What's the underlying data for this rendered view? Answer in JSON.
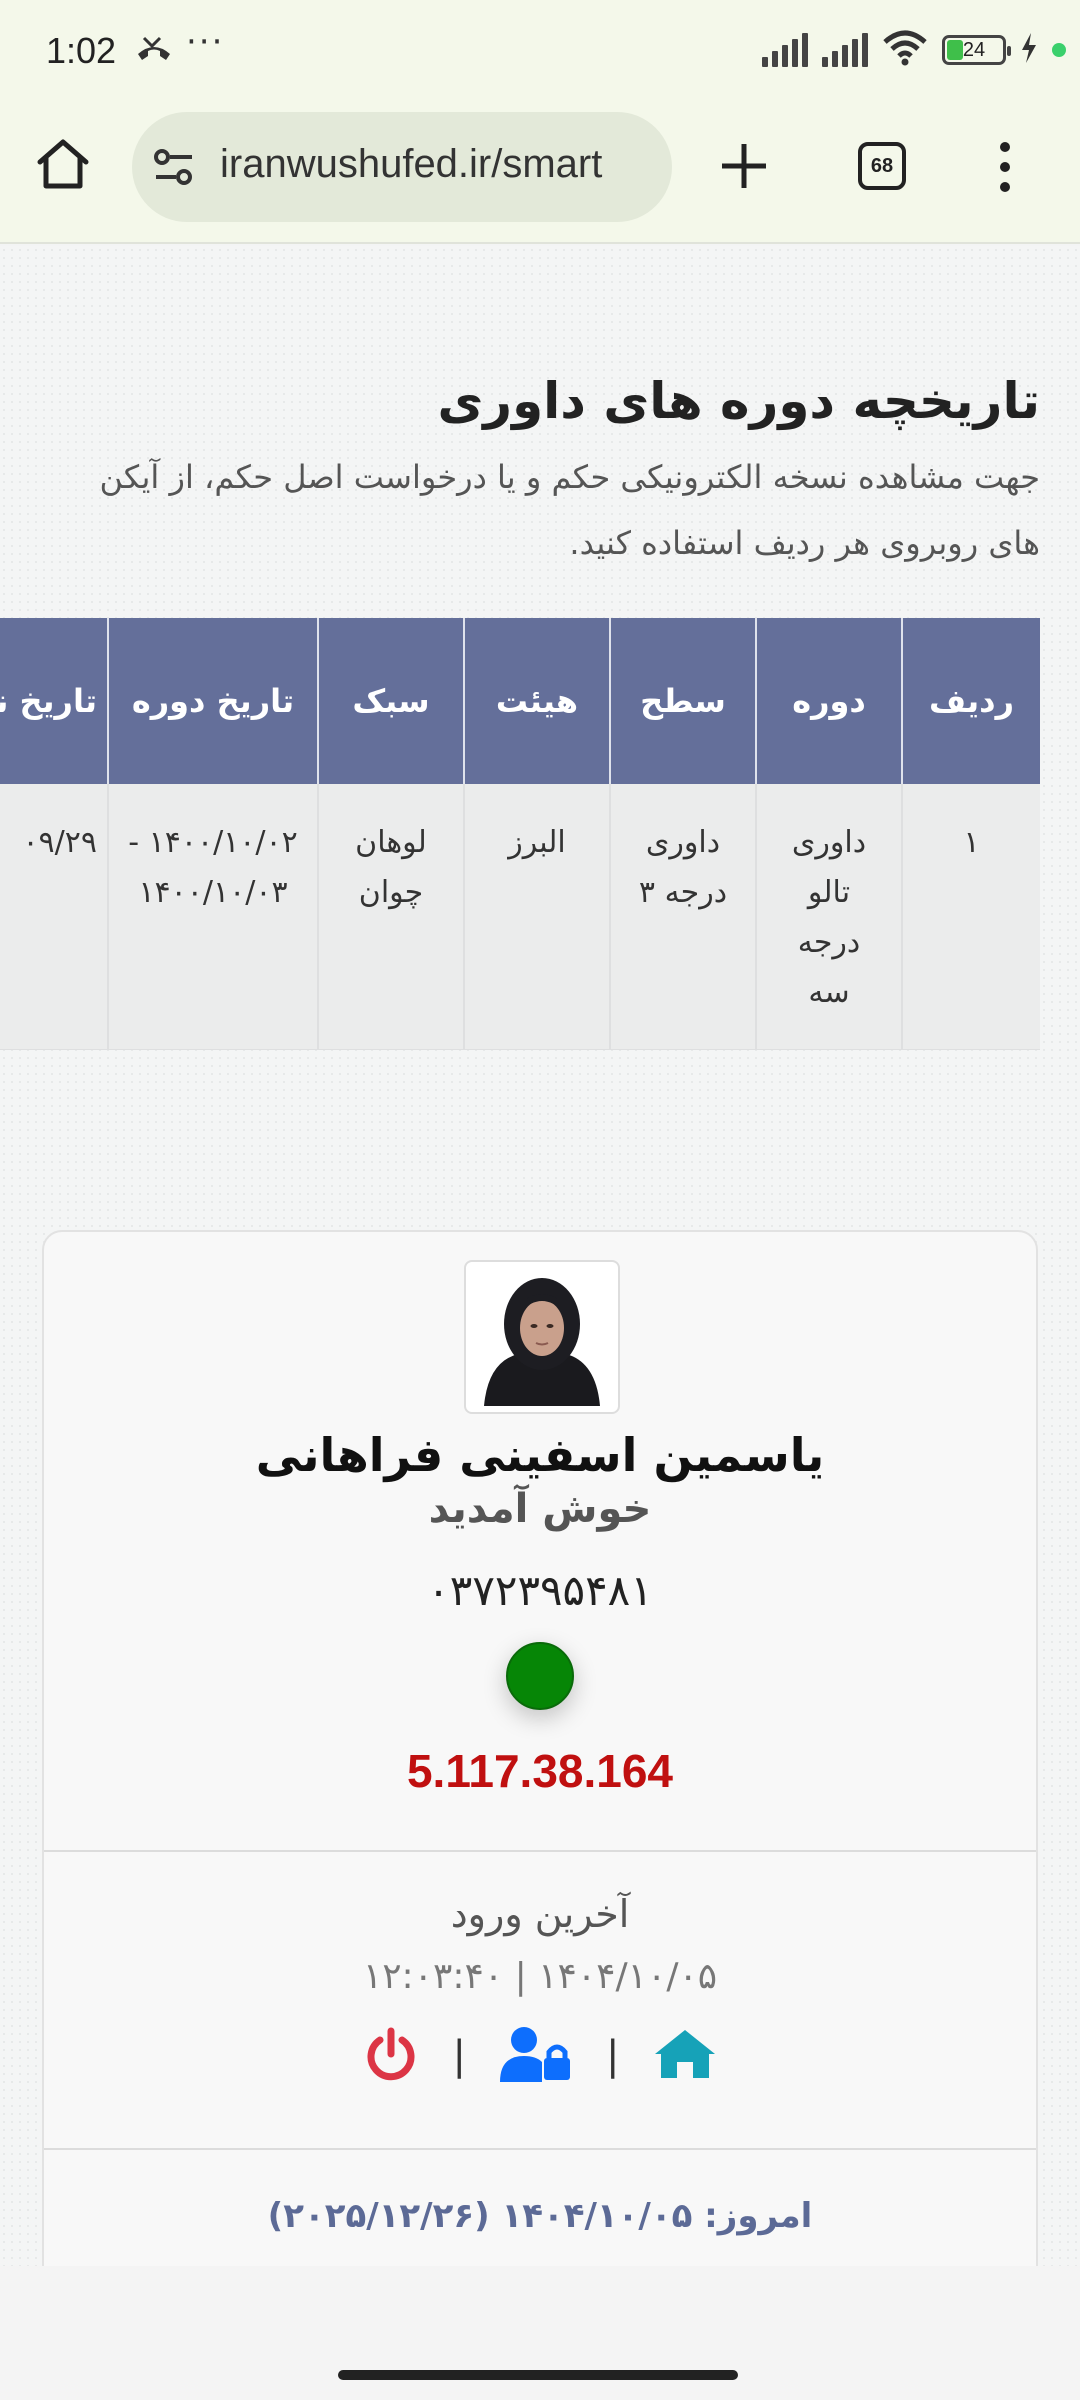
{
  "status_bar": {
    "time": "1:02",
    "dots": "···",
    "battery": "24"
  },
  "browser": {
    "url": "iranwushufed.ir/smart",
    "tab_count": "68"
  },
  "history": {
    "title": "تاریخچه دوره های داوری",
    "description": "جهت مشاهده نسخه الکترونیکی حکم و یا درخواست اصل حکم، از آیکن های روبروی هر ردیف استفاده کنید.",
    "columns": [
      "ردیف",
      "دوره",
      "سطح",
      "هیئت",
      "سبک",
      "تاریخ دوره",
      "تاریخ نا"
    ],
    "rows": [
      {
        "index": "۱",
        "course": "داوری تالو درجه سه",
        "level": "داوری درجه ۳",
        "board": "البرز",
        "style": "لوهان چوان",
        "dates": "۱۴۰۰/۱۰/۰۲ - ۱۴۰۰/۱۰/۰۳",
        "issue_date": "۰۹/۲۹"
      }
    ]
  },
  "profile": {
    "name": "یاسمین اسفینی فراهانی",
    "welcome": "خوش آمدید",
    "national_id": "۰۳۷۲۳۹۵۴۸۱",
    "status_color": "#068606",
    "ip": "5.117.38.164",
    "last_login_label": "آخرین ورود",
    "last_login_value": "۱۴۰۴/۱۰/۰۵ | ۱۲:۰۳:۴۰",
    "icons": [
      "home-icon",
      "user-lock-icon",
      "power-icon"
    ],
    "today": "امروز: ۱۴۰۴/۱۰/۰۵ (۲۰۲۵/۱۲/۲۶)"
  },
  "colors": {
    "table_header": "#646f9a",
    "ip_text": "#c01010",
    "home_icon": "#16a2b8",
    "user_icon": "#0d6efd",
    "power_icon": "#dc3545"
  }
}
